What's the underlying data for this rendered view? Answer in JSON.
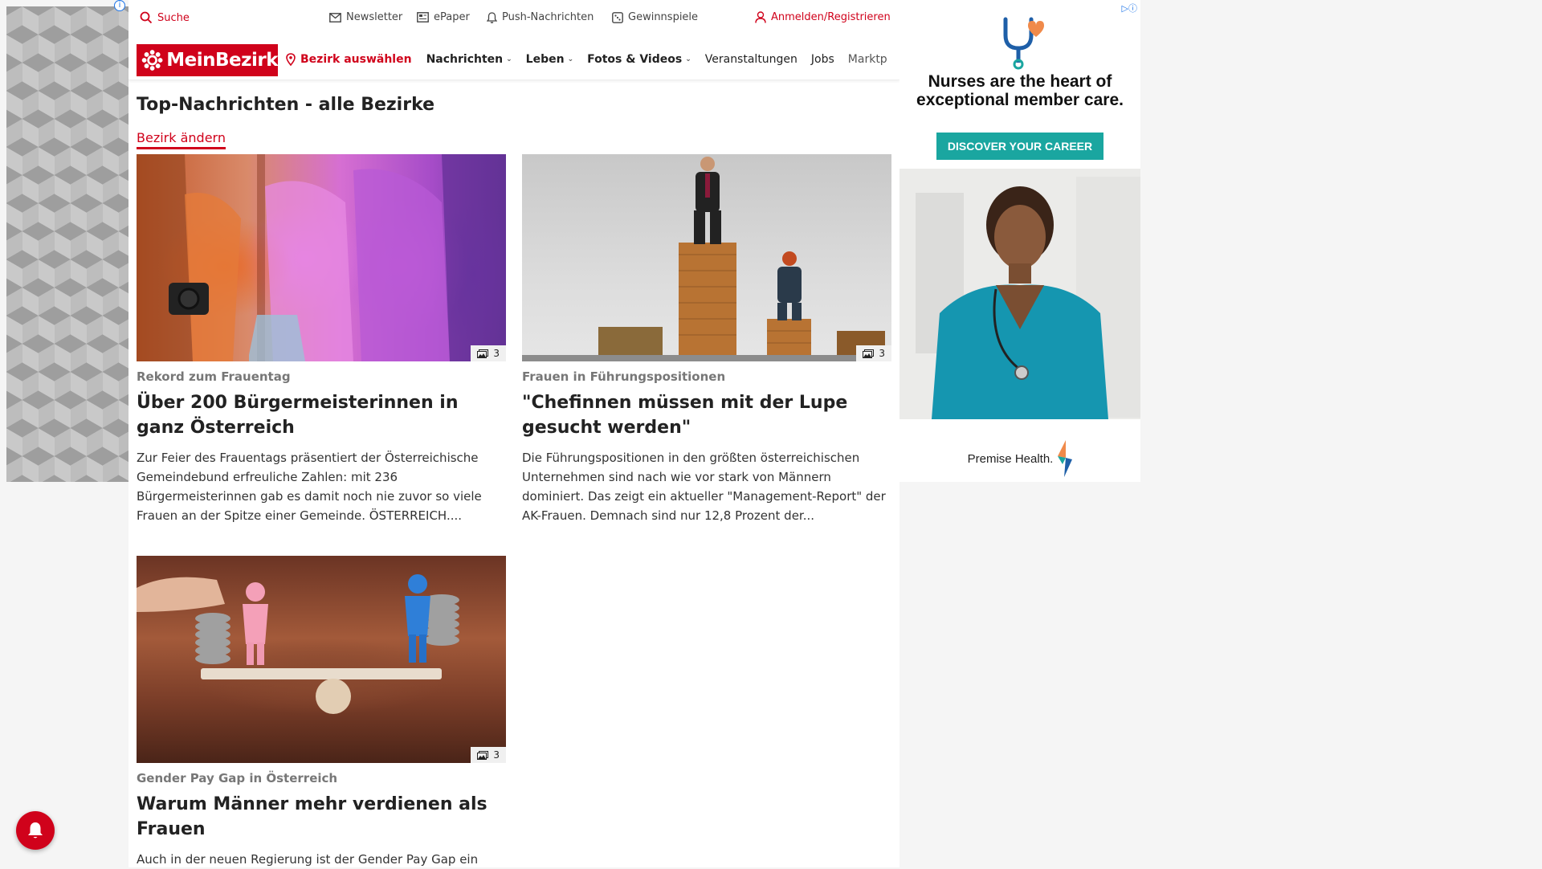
{
  "topbar": {
    "search_label": "Suche",
    "newsletter_label": "Newsletter",
    "epaper_label": "ePaper",
    "push_label": "Push-Nachrichten",
    "gewinnspiele_label": "Gewinnspiele",
    "login_label": "Anmelden/Registrieren"
  },
  "nav": {
    "logo_text": "MeinBezirk",
    "bezirk_label": "Bezirk auswählen",
    "items": [
      {
        "label": "Nachrichten"
      },
      {
        "label": "Leben"
      },
      {
        "label": "Fotos & Videos"
      },
      {
        "label": "Veranstaltungen"
      },
      {
        "label": "Jobs"
      },
      {
        "label": "Marktplatz"
      }
    ]
  },
  "section": {
    "title": "Top-Nachrichten - alle Bezirke",
    "change_link": "Bezirk ändern"
  },
  "articles": [
    {
      "image_count": "3",
      "kicker": "Rekord zum Frauentag",
      "headline": "Über 200 Bürgermeisterinnen in ganz Österreich",
      "teaser": "Zur Feier des Frauentags präsentiert der Österreichische Gemeindebund erfreuliche Zahlen: mit 236 Bürgermeisterinnen gab es damit noch nie zuvor so viele Frauen an der Spitze einer Gemeinde. ÖSTERREICH...."
    },
    {
      "image_count": "3",
      "kicker": "Frauen in Führungspositionen",
      "headline": "\"Chefinnen müssen mit der Lupe gesucht werden\"",
      "teaser": "Die Führungspositionen in den größten österreichischen Unternehmen sind nach wie vor stark von Männern dominiert. Das zeigt ein aktueller \"Management-Report\" der AK-Frauen. Demnach sind nur 12,8 Prozent der..."
    },
    {
      "image_count": "3",
      "kicker": "Gender Pay Gap in Österreich",
      "headline": "Warum Männer mehr verdienen als Frauen",
      "teaser": "Auch in der neuen Regierung ist der Gender Pay Gap ein"
    }
  ],
  "right_ad": {
    "headline": "Nurses are the heart of exceptional member care.",
    "cta": "DISCOVER YOUR CAREER",
    "brand": "Premise Health."
  },
  "colors": {
    "brand_red": "#d0021b",
    "ad_teal": "#1aa6a0"
  }
}
